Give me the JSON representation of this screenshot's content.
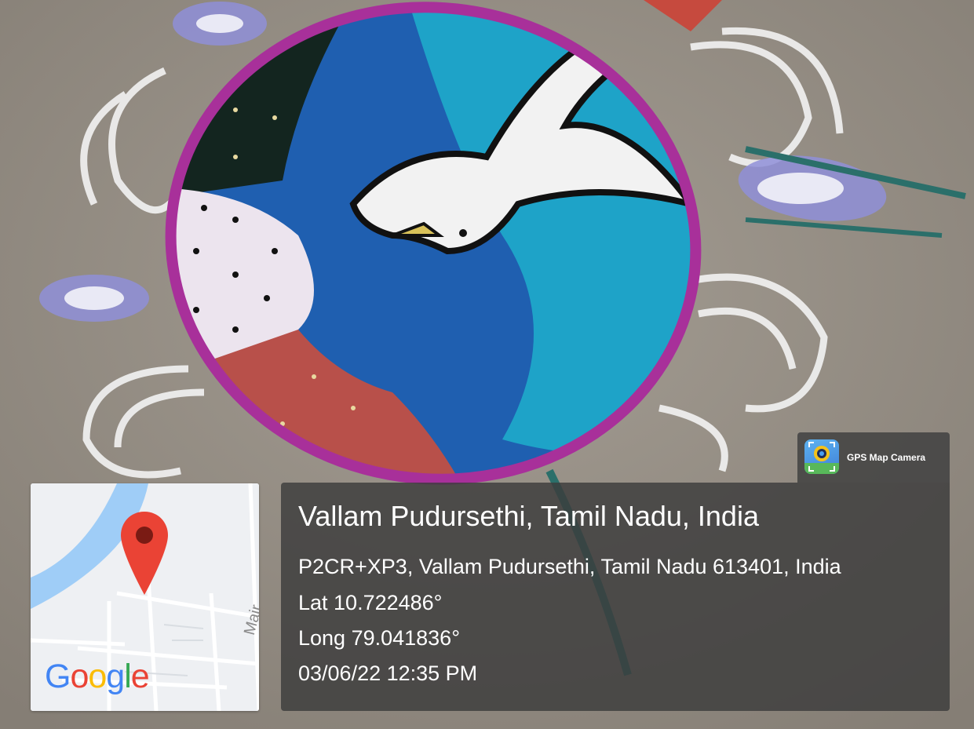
{
  "app_badge": {
    "label": "GPS Map Camera",
    "icon": "gps-map-camera-app-icon"
  },
  "map": {
    "logo_letters": [
      "G",
      "o",
      "o",
      "g",
      "l",
      "e"
    ],
    "logo_colors": [
      "#4285F4",
      "#EA4335",
      "#FBBC05",
      "#4285F4",
      "#34A853",
      "#EA4335"
    ],
    "street_label": "Mair",
    "pin_color": "#EA4335"
  },
  "location": {
    "title": "Vallam Pudursethi, Tamil Nadu, India",
    "address": "P2CR+XP3, Vallam Pudursethi, Tamil Nadu 613401, India",
    "lat": "Lat 10.722486°",
    "long": "Long 79.041836°",
    "datetime": "03/06/22 12:35 PM"
  },
  "photo": {
    "subject": "rangoli-dove-circle",
    "colors": {
      "ground": "#9a938a",
      "ring": "#a8309a",
      "blue": "#1f5fb0",
      "cyan": "#1ea3c8",
      "red": "#b8504a",
      "dark": "#13251f",
      "white": "#f2f2f2"
    }
  }
}
